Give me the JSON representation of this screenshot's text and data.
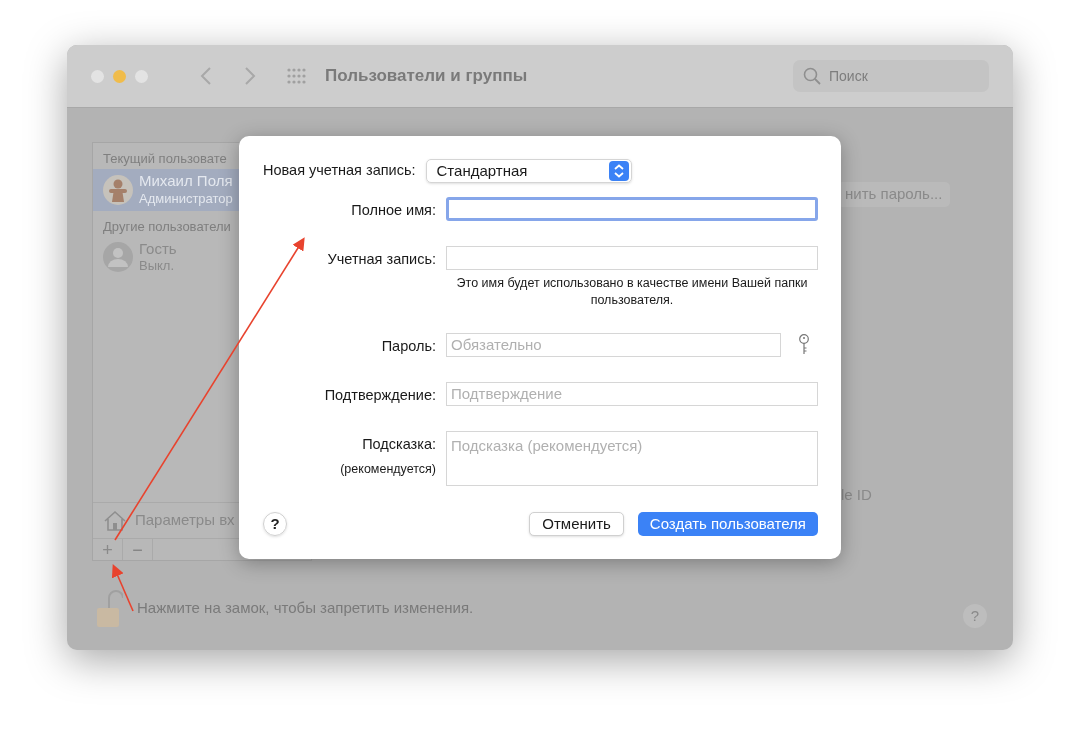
{
  "window": {
    "title": "Пользователи и группы",
    "search_placeholder": "Поиск"
  },
  "sidebar": {
    "current_header": "Текущий пользовате",
    "users": [
      {
        "name": "Михаил Поля",
        "role": "Администратор",
        "selected": true,
        "kind": "picture"
      },
      {
        "name": "Гость",
        "role": "Выкл.",
        "selected": false,
        "kind": "generic"
      }
    ],
    "other_header": "Другие пользователи",
    "login_options": "Параметры вх",
    "add": "+",
    "remove": "−"
  },
  "background": {
    "change_password": "нить пароль...",
    "apple_id": "le ID"
  },
  "lock_text": "Нажмите на замок, чтобы запретить изменения.",
  "help": "?",
  "dialog": {
    "account_type_label": "Новая учетная запись:",
    "account_type_value": "Стандартная",
    "fields": [
      {
        "label": "Полное имя:",
        "kind": "text",
        "focused": true
      },
      {
        "label": "Учетная запись:",
        "kind": "text",
        "focused": false,
        "note": "Это имя будет использовано в качестве имени Вашей папки пользователя."
      },
      {
        "label": "Пароль:",
        "kind": "password",
        "focused": false,
        "placeholder": "Обязательно"
      },
      {
        "label": "Подтверждение:",
        "kind": "text",
        "focused": false,
        "placeholder": "Подтверждение"
      },
      {
        "label": "Подсказка:",
        "sublabel": "(рекомендуется)",
        "kind": "textarea",
        "focused": false,
        "placeholder": "Подсказка (рекомендуется)"
      }
    ],
    "help": "?",
    "buttons": [
      {
        "label": "Отменить",
        "kind": "cancel"
      },
      {
        "label": "Создать пользователя",
        "kind": "default"
      }
    ]
  }
}
